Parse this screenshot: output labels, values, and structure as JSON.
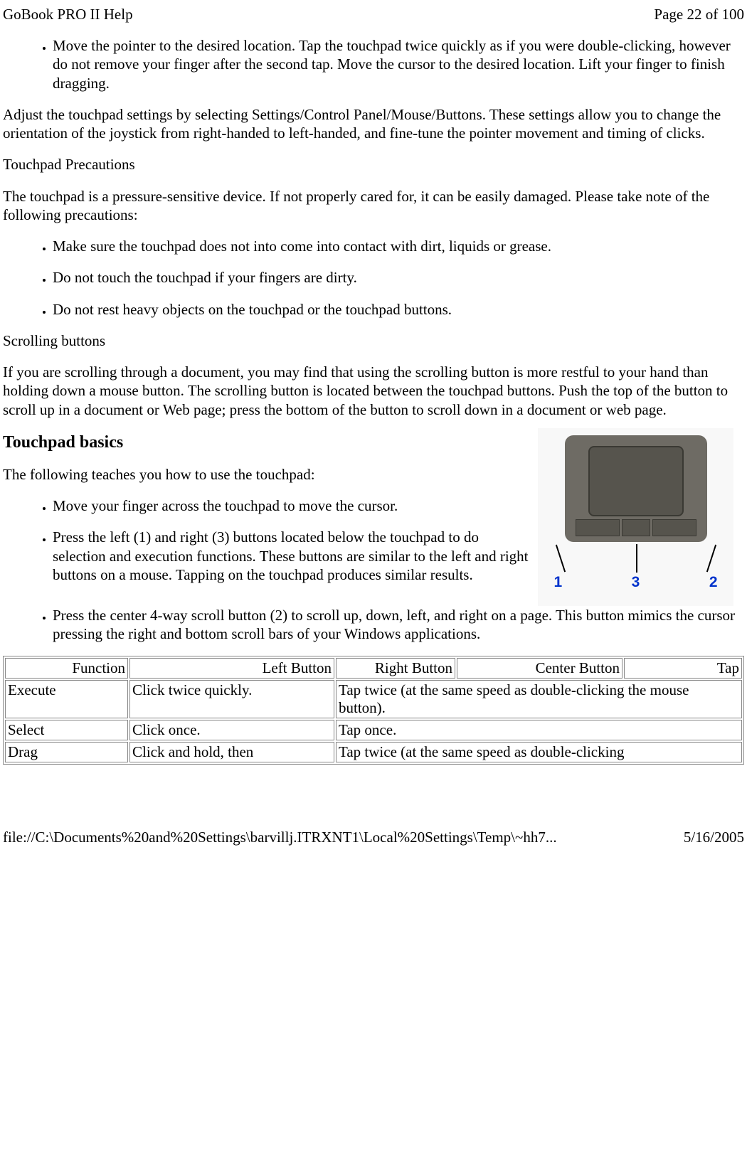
{
  "header": {
    "title": "GoBook PRO II Help",
    "page_info": "Page 22 of 100"
  },
  "intro_list": {
    "item1": "Move the pointer to the desired location. Tap the touchpad twice quickly as if you were double-clicking, however do not remove your finger after the second tap. Move the cursor to the desired location. Lift your finger to finish dragging."
  },
  "paragraphs": {
    "adjust": "Adjust the touchpad settings by selecting Settings/Control Panel/Mouse/Buttons. These settings allow you to change the orientation of the joystick from right-handed to left-handed, and fine-tune the pointer movement and timing of clicks.",
    "precautions_heading": "Touchpad Precautions",
    "precautions_intro": "The touchpad is a pressure-sensitive device.  If not properly cared for, it can be easily damaged.  Please take note of the following precautions:",
    "scrolling_heading": "Scrolling buttons",
    "scrolling_body": "If you are scrolling through a document, you may find that using the scrolling button is more restful to your hand than holding down a mouse button.  The scrolling button is located between the touchpad buttons.  Push the top of the button to scroll up in a document or Web page; press the bottom of the button to scroll down in a document or web page."
  },
  "precautions_list": {
    "item1": "Make sure the touchpad does not into come into contact with dirt, liquids or grease.",
    "item2": "Do not touch the touchpad if your fingers are dirty.",
    "item3": "Do not rest heavy objects on the touchpad or the touchpad buttons."
  },
  "touchpad_basics": {
    "heading": "Touchpad basics",
    "intro": "The following teaches you how to use the touchpad:",
    "item1": "Move your finger across the touchpad to move the cursor.",
    "item2": "Press the left (1) and right (3) buttons located below the touchpad to do selection and execution functions. These buttons are similar to the left and right buttons on a mouse. Tapping on the touchpad produces similar results.",
    "item3": "Press the center 4-way scroll button (2) to scroll up, down, left, and right on a page. This button mimics the cursor pressing the right and bottom scroll bars of your Windows applications."
  },
  "image_labels": {
    "l1": "1",
    "l3": "3",
    "l2": "2"
  },
  "table": {
    "headers": {
      "function": "Function",
      "left": "Left Button",
      "right": "Right Button",
      "center": "Center Button",
      "tap": "Tap"
    },
    "rows": {
      "execute": {
        "func": "Execute",
        "left": "Click twice quickly.",
        "right": "Tap twice (at the same speed as double-clicking the mouse button)."
      },
      "select": {
        "func": "Select",
        "left": "Click once.",
        "right": "Tap once."
      },
      "drag": {
        "func": "Drag",
        "left": "Click and hold, then",
        "right": "Tap twice (at the same speed as double-clicking"
      }
    }
  },
  "footer": {
    "path": "file://C:\\Documents%20and%20Settings\\barvillj.ITRXNT1\\Local%20Settings\\Temp\\~hh7...",
    "date": "5/16/2005"
  }
}
